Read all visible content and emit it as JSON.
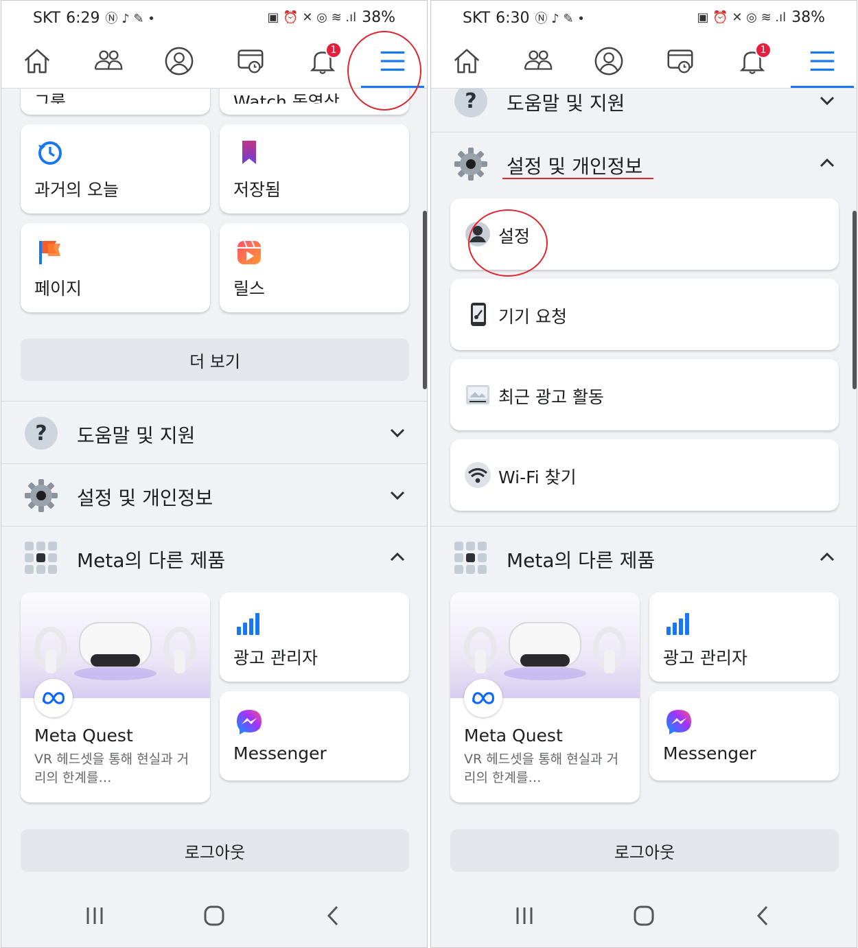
{
  "colors": {
    "accent": "#1877f2",
    "annotation": "#e0262c",
    "badge": "#e41e3f"
  },
  "status": {
    "left": {
      "carrier": "SKT",
      "time": "6:29"
    },
    "right": {
      "carrier": "SKT",
      "time": "6:30"
    },
    "battery": "38%"
  },
  "nav": {
    "icons": [
      "home-icon",
      "friends-icon",
      "profile-icon",
      "watch-icon",
      "notifications-icon",
      "menu-icon"
    ],
    "notification_count": "1"
  },
  "left": {
    "cut_cards": [
      "그룹",
      "Watch 동영상"
    ],
    "shortcuts": [
      {
        "label": "과거의 오늘",
        "icon": "memories-icon"
      },
      {
        "label": "저장됨",
        "icon": "saved-icon"
      },
      {
        "label": "페이지",
        "icon": "pages-icon"
      },
      {
        "label": "릴스",
        "icon": "reels-icon"
      }
    ],
    "see_more": "더 보기",
    "help_section": "도움말 및 지원",
    "settings_section": "설정 및 개인정보"
  },
  "right": {
    "help_section": "도움말 및 지원",
    "settings_section": "설정 및 개인정보",
    "settings_items": [
      "설정",
      "기기 요청",
      "최근 광고 활동",
      "Wi-Fi 찾기"
    ]
  },
  "meta_products": {
    "section_title": "Meta의 다른 제품",
    "quest": {
      "title": "Meta Quest",
      "description": "VR 헤드셋을 통해 현실과 거리의 한계를…"
    },
    "ads_manager": "광고 관리자",
    "messenger": "Messenger"
  },
  "logout": "로그아웃"
}
